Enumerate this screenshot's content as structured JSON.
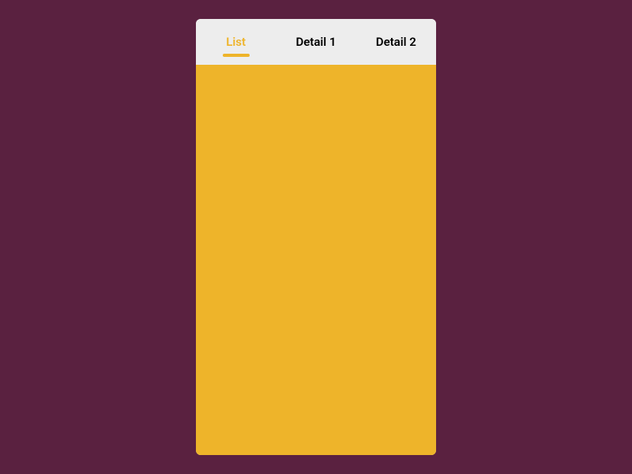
{
  "tabs": [
    {
      "label": "List",
      "active": true
    },
    {
      "label": "Detail 1",
      "active": false
    },
    {
      "label": "Detail 2",
      "active": false
    }
  ],
  "colors": {
    "background": "#5a2140",
    "device": "#ededed",
    "accent": "#eeb42a"
  }
}
